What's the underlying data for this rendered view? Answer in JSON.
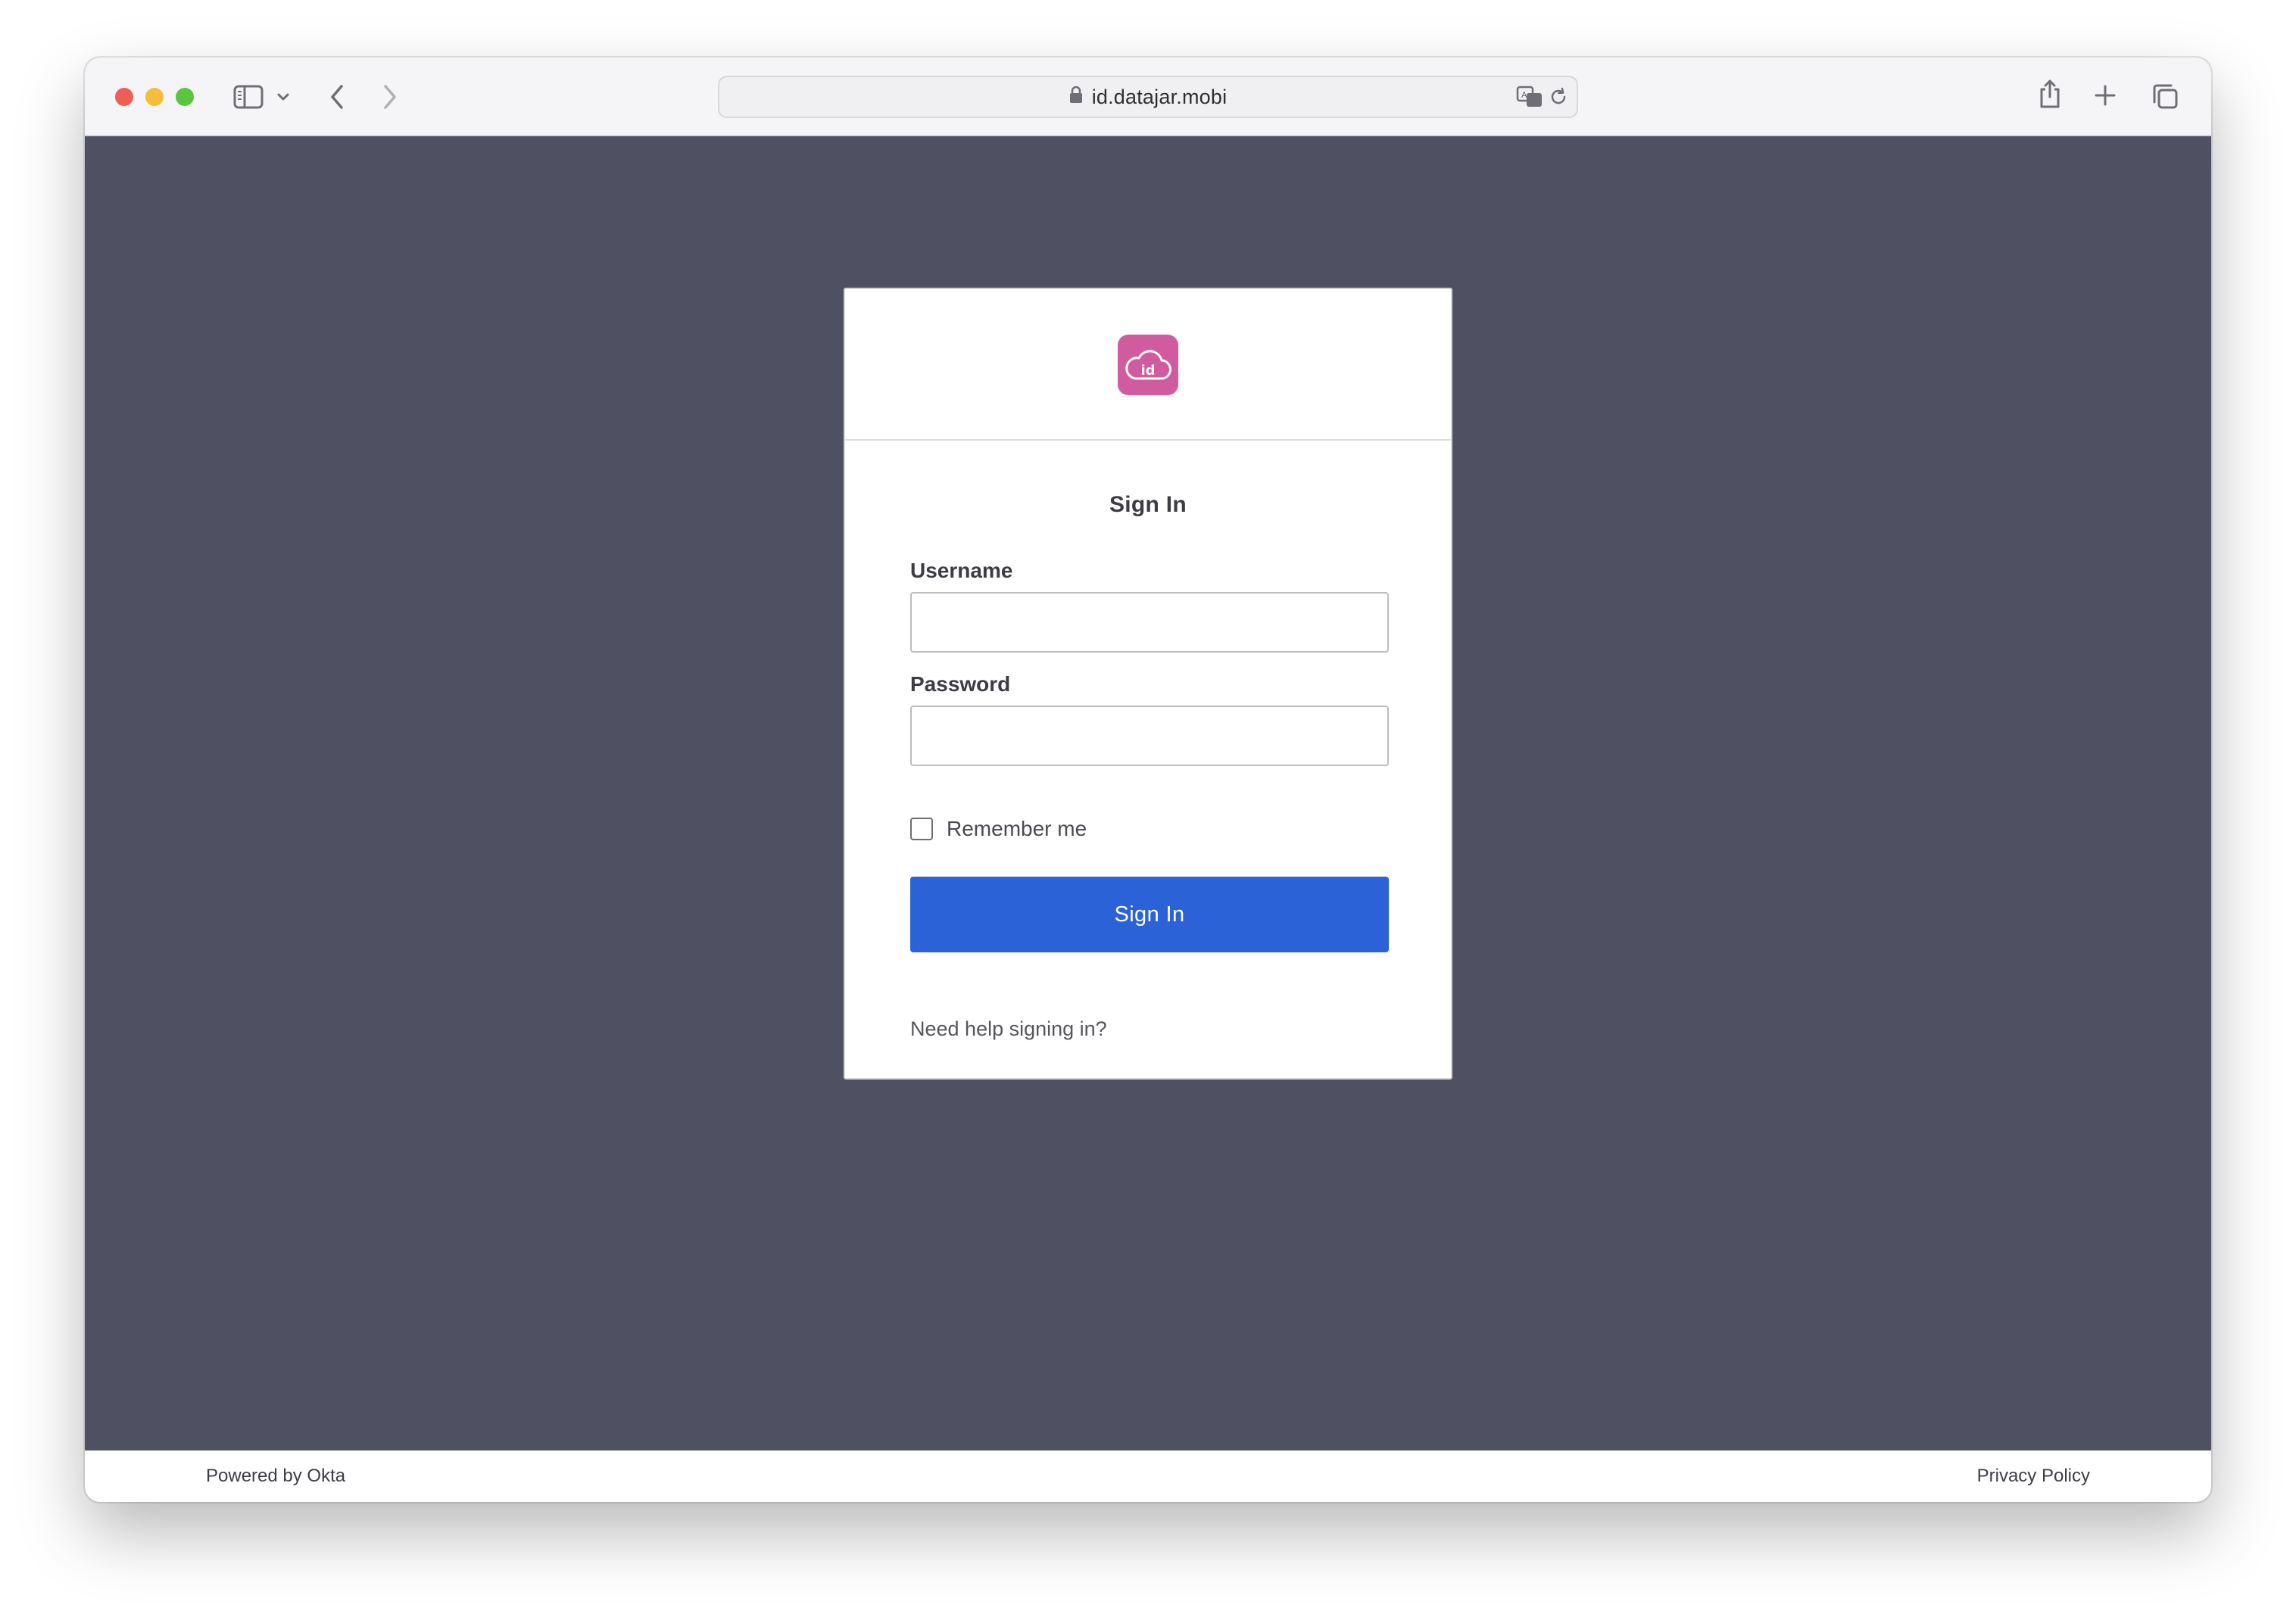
{
  "browser": {
    "url": "id.datajar.mobi"
  },
  "logo": {
    "text": "id",
    "color": "#d05b9e"
  },
  "form": {
    "title": "Sign In",
    "username_label": "Username",
    "username_value": "",
    "password_label": "Password",
    "password_value": "",
    "remember_label": "Remember me",
    "remember_checked": false,
    "submit_label": "Sign In",
    "submit_color": "#2c62d8",
    "help_link": "Need help signing in?"
  },
  "footer": {
    "powered_by": "Powered by Okta",
    "privacy": "Privacy Policy"
  },
  "theme": {
    "page_background": "#4f5163"
  }
}
